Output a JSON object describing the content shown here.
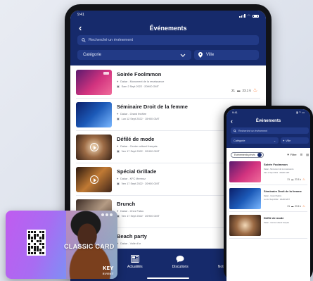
{
  "tablet": {
    "status_time": "9:41",
    "title": "Événements",
    "search_placeholder": "Recherché un événement",
    "category_label": "Catégorie",
    "city_label": "Ville",
    "events": [
      {
        "name": "Soirée Foolmmon",
        "location": "Dakar - Monument de la renaissance",
        "date": "Sam 2 Sept 2022 · 20H00 GMT",
        "comments": "21",
        "hot": "23.1 k",
        "thumb": "g1"
      },
      {
        "name": "Séminaire Droit de la femme",
        "location": "Dakar - Grand théâtre",
        "date": "Lun 12 Sept 2022 · 10H00 GMT",
        "thumb": "g2"
      },
      {
        "name": "Défilé de mode",
        "location": "Dakar - Centre culturel français",
        "date": "Ven 17 Sept 2022 · 20H00 GMT",
        "thumb": "g3"
      },
      {
        "name": "Spécial Grillade",
        "location": "Dakar - KFC Mermoz",
        "date": "Ven 17 Sept 2022 · 20H00 GMT",
        "thumb": "g4"
      },
      {
        "name": "Brunch",
        "location": "Dakar - Chez Fatou",
        "date": "Ven 17 Sept 2022 · 20H00 GMT",
        "thumb": "g5"
      },
      {
        "name": "Beach party",
        "location": "Dakar - Voile d'or",
        "date": "Ven 17 Sept 2022 · 20H00 GMT",
        "thumb": "g6"
      }
    ],
    "tabs": [
      {
        "label": "Actualités",
        "icon": "news-icon"
      },
      {
        "label": "Discutions",
        "icon": "chat-icon"
      },
      {
        "label": "Notifications",
        "icon": "bell-icon"
      }
    ]
  },
  "phone": {
    "status_time": "9:41",
    "title": "Événements",
    "search_placeholder": "Recherché un événement",
    "category_label": "Catégorie",
    "city_label": "Ville",
    "sort_label": "Evénements privés",
    "filter_label": "Filtre",
    "events": [
      {
        "name": "Soirée Foolmmon",
        "location": "Dakar - Monument de la renaissance",
        "date": "Sam 2 Sept 2022 · 20H00 GMT",
        "comments": "21",
        "hot": "23.1 k",
        "thumb": "g1"
      },
      {
        "name": "Séminaire Droit de la femme",
        "location": "Dakar - Grand théâtre",
        "date": "Lun 12 Sept 2022 · 10H00 GMT",
        "comments": "21",
        "hot": "23.1 k",
        "thumb": "g2"
      },
      {
        "name": "Défilé de mode",
        "location": "Dakar - Centre culturel français",
        "date": "",
        "thumb": "g3"
      }
    ]
  },
  "card": {
    "label": "CLASSIC CARD",
    "logo_top": "KEY",
    "logo_bottom": "EVENT"
  },
  "colors": {
    "header_navy": "#162a6b",
    "field_blue": "#223a86",
    "flame": "#ff6a1a"
  }
}
